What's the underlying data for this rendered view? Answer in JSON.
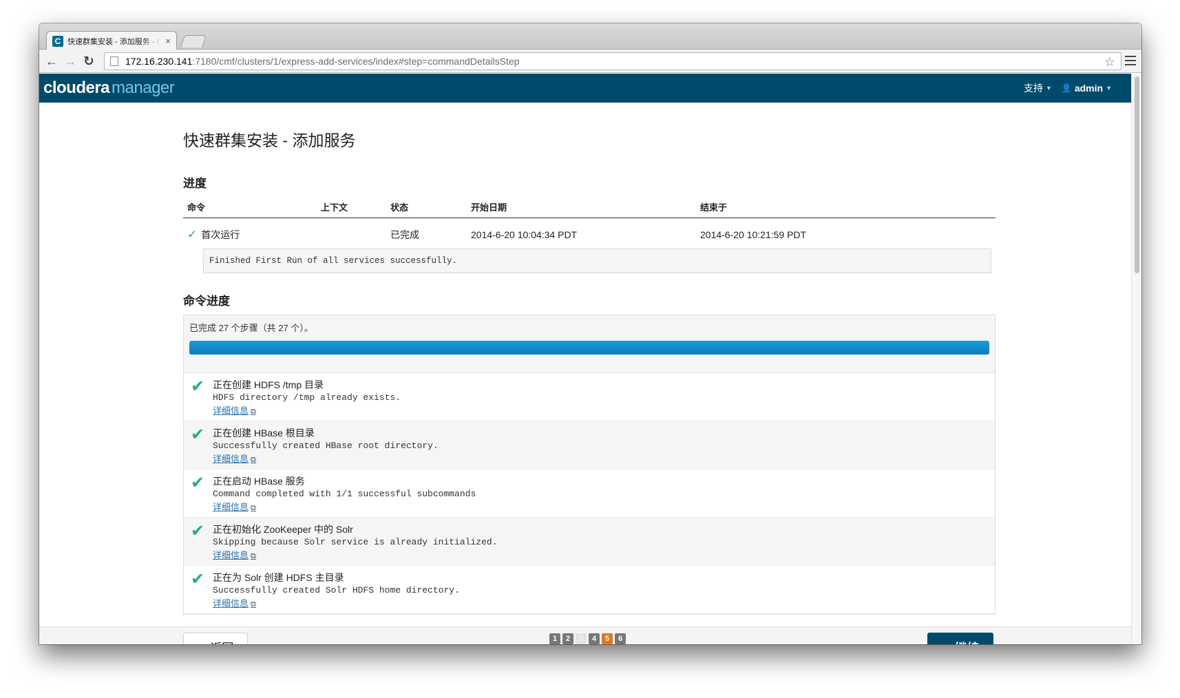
{
  "browser": {
    "tab_title": "快速群集安装 - 添加服务 - Cloudera Manager",
    "tab_favicon": "C",
    "close_glyph": "×",
    "url_host": "172.16.230.141",
    "url_rest": ":7180/cmf/clusters/1/express-add-services/index#step=commandDetailsStep",
    "back_glyph": "←",
    "forward_glyph": "→",
    "reload_glyph": "↻",
    "star_glyph": "☆"
  },
  "header": {
    "logo_main": "cloudera",
    "logo_sub": "manager",
    "support_label": "支持",
    "user_label": "admin",
    "caret": "▼",
    "user_glyph": "👤"
  },
  "main": {
    "title": "快速群集安装 - 添加服务",
    "progress_title": "进度",
    "columns": [
      "命令",
      "上下文",
      "状态",
      "开始日期",
      "结束于"
    ],
    "row": {
      "command": "首次运行",
      "context": "",
      "status": "已完成",
      "start": "2014-6-20 10:04:34 PDT",
      "end": "2014-6-20 10:21:59 PDT",
      "check_glyph": "✓"
    },
    "result_message": "Finished First Run of all services successfully.",
    "cmd_progress_title": "命令进度",
    "cmd_summary": "已完成 27 个步骤（共 27 个）。",
    "progress_percent": 100,
    "steps": [
      {
        "title": "正在创建 HDFS /tmp 目录",
        "message": "HDFS directory /tmp already exists.",
        "link": "详细信息"
      },
      {
        "title": "正在创建 HBase 根目录",
        "message": "Successfully created HBase root directory.",
        "link": "详细信息"
      },
      {
        "title": "正在启动 HBase 服务",
        "message": "Command completed with 1/1 successful subcommands",
        "link": "详细信息"
      },
      {
        "title": "正在初始化 ZooKeeper 中的 Solr",
        "message": "Skipping because Solr service is already initialized.",
        "link": "详细信息"
      },
      {
        "title": "正在为 Solr 创建 HDFS 主目录",
        "message": "Successfully created Solr HDFS home directory.",
        "link": "详细信息"
      }
    ],
    "step_check_glyph": "✔",
    "ext_glyph": "⧉"
  },
  "footer": {
    "back_label": "返回",
    "continue_label": "继续",
    "back_glyph": "⏮",
    "continue_glyph": "⏭",
    "pages": [
      "1",
      "2",
      "3",
      "4",
      "5",
      "6"
    ],
    "current_page": "5"
  },
  "colors": {
    "header_bg": "#004b6b",
    "accent_orange": "#e7731f",
    "check_green": "#2ba88c",
    "progress_blue": "#0a7cbd"
  }
}
